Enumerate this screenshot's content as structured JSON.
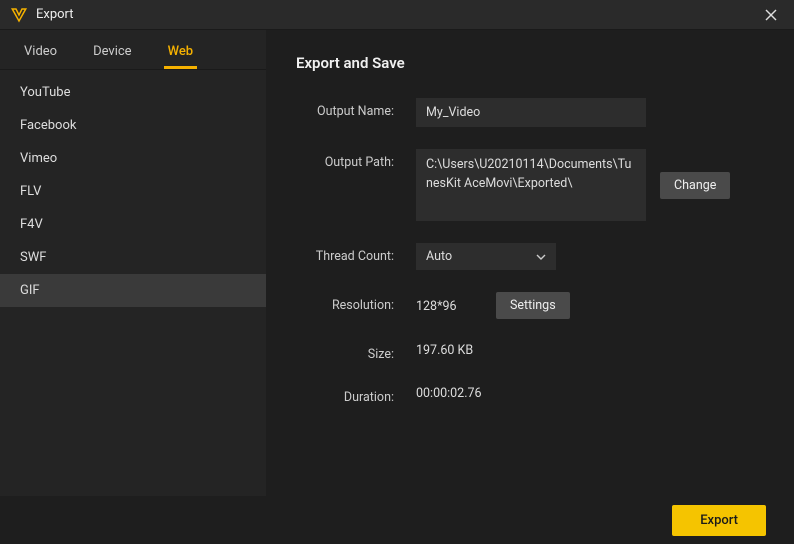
{
  "window": {
    "title": "Export"
  },
  "tabs": [
    {
      "label": "Video",
      "active": false
    },
    {
      "label": "Device",
      "active": false
    },
    {
      "label": "Web",
      "active": true
    }
  ],
  "formats": [
    {
      "label": "YouTube",
      "selected": false
    },
    {
      "label": "Facebook",
      "selected": false
    },
    {
      "label": "Vimeo",
      "selected": false
    },
    {
      "label": "FLV",
      "selected": false
    },
    {
      "label": "F4V",
      "selected": false
    },
    {
      "label": "SWF",
      "selected": false
    },
    {
      "label": "GIF",
      "selected": true
    }
  ],
  "section": {
    "title": "Export and Save"
  },
  "fields": {
    "output_name_label": "Output Name:",
    "output_name_value": "My_Video",
    "output_path_label": "Output Path:",
    "output_path_value": "C:\\Users\\U20210114\\Documents\\TunesKit AceMovi\\Exported\\",
    "change_label": "Change",
    "thread_count_label": "Thread Count:",
    "thread_count_value": "Auto",
    "resolution_label": "Resolution:",
    "resolution_value": "128*96",
    "settings_label": "Settings",
    "size_label": "Size:",
    "size_value": "197.60 KB",
    "duration_label": "Duration:",
    "duration_value": "00:00:02.76"
  },
  "footer": {
    "export_label": "Export"
  }
}
